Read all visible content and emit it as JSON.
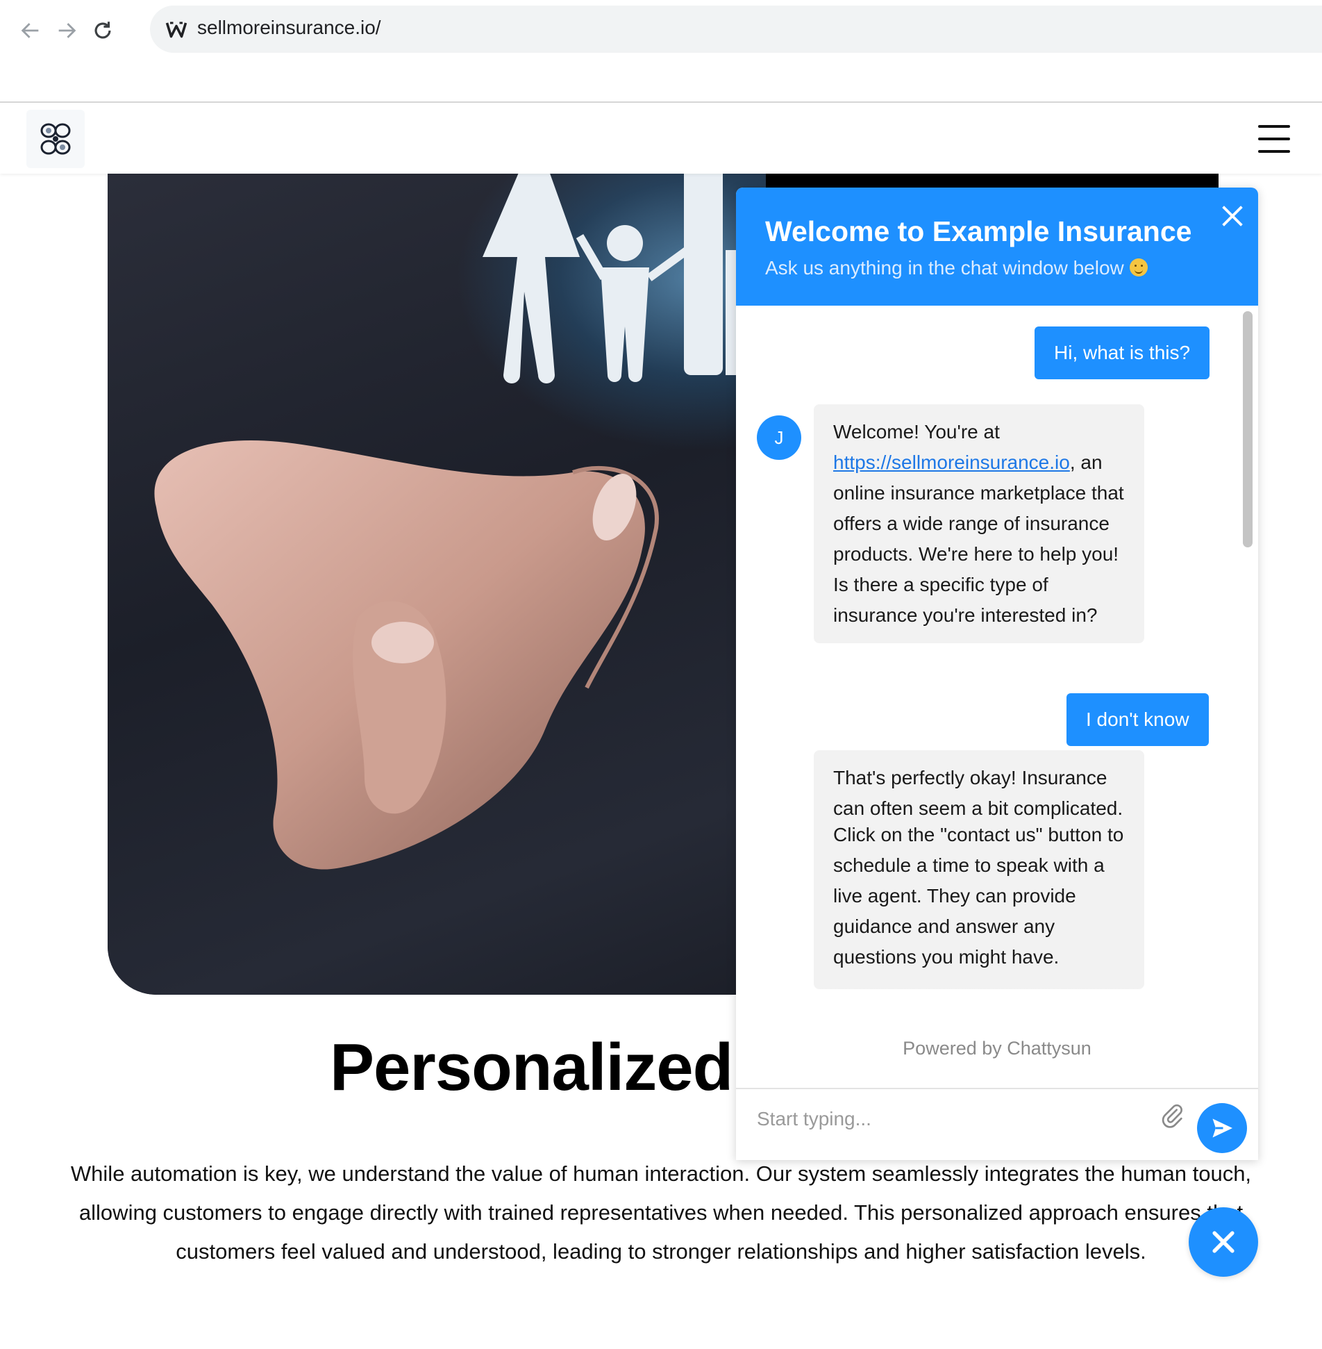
{
  "browser": {
    "url": "sellmoreinsurance.io/"
  },
  "hero": {
    "title": "Personalized",
    "body": "While automation is key, we understand the value of human interaction. Our system seamlessly integrates the human touch, allowing customers to engage directly with trained representatives when needed. This personalized approach ensures that customers feel valued and understood, leading to stronger relationships and higher satisfaction levels."
  },
  "chat": {
    "title": "Welcome to Example Insurance",
    "subtitle": "Ask us anything in the chat window below",
    "avatar_initial": "J",
    "messages": [
      {
        "from": "user",
        "text": "Hi, what is this?"
      },
      {
        "from": "bot",
        "pre_link": "Welcome! You're at ",
        "link": "https://sellmoreinsurance.io",
        "post_link": ", an online insurance marketplace that offers a wide range of insurance products. We're here to help you! Is there a specific type of insurance you're interested in?"
      },
      {
        "from": "user",
        "text": "I don't know"
      },
      {
        "from": "bot",
        "text_1": "That's perfectly okay! Insurance can often seem a bit complicated.",
        "text_2": "Click on the \"contact us\" button to schedule a time to speak with a live agent. They can provide guidance and answer any questions you might have."
      }
    ],
    "powered_by": "Powered by Chattysun",
    "input_placeholder": "Start typing..."
  },
  "colors": {
    "accent": "#1e90ff"
  },
  "icons": [
    "back-arrow-icon",
    "forward-arrow-icon",
    "reload-icon",
    "site-favicon-icon",
    "logo-icon",
    "hamburger-menu-icon",
    "close-icon",
    "paperclip-icon",
    "send-icon",
    "smile-emoji-icon"
  ]
}
